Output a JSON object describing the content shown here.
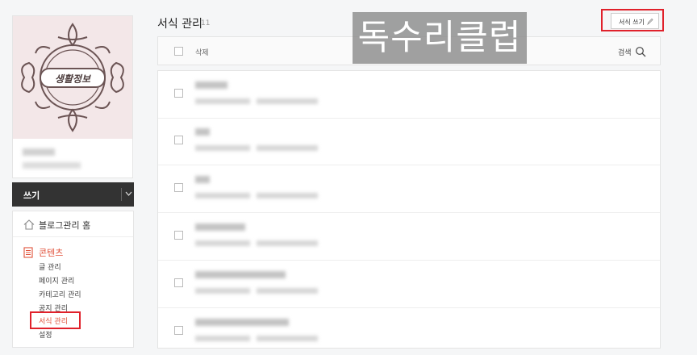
{
  "profile": {
    "logo_text": "생활정보",
    "name_blurred": "",
    "sub_blurred": ""
  },
  "write_button": {
    "label": "쓰기",
    "dropdown_icon": "chevron-down-icon"
  },
  "sidebar_menu": {
    "home": {
      "label": "블로그관리 홈",
      "icon": "home-icon"
    },
    "content_section": {
      "label": "콘텐츠",
      "icon": "document-icon"
    },
    "items": [
      {
        "label": "글 관리",
        "active": false
      },
      {
        "label": "페이지 관리",
        "active": false
      },
      {
        "label": "카테고리 관리",
        "active": false
      },
      {
        "label": "공지 관리",
        "active": false
      },
      {
        "label": "서식 관리",
        "active": true
      },
      {
        "label": "설정",
        "active": false
      }
    ]
  },
  "main": {
    "title": "서식 관리",
    "count": "11",
    "new_template_button": {
      "label": "서식 쓰기",
      "icon": "pencil-icon"
    },
    "watermark": "독수리클럽",
    "list_header": {
      "delete_label": "삭제",
      "search_label": "검색",
      "search_icon": "search-icon"
    },
    "rows_note": "",
    "rows": [
      {
        "title": "",
        "meta": ""
      },
      {
        "title": "",
        "meta": ""
      },
      {
        "title": "",
        "meta": ""
      },
      {
        "title": "",
        "meta": ""
      },
      {
        "title": "",
        "meta": ""
      },
      {
        "title": "",
        "meta": ""
      }
    ]
  },
  "colors": {
    "accent_red": "#e0512b",
    "highlight_box": "#e0212b",
    "write_bar_bg": "#333333",
    "logo_bg": "#f3e7e8"
  }
}
